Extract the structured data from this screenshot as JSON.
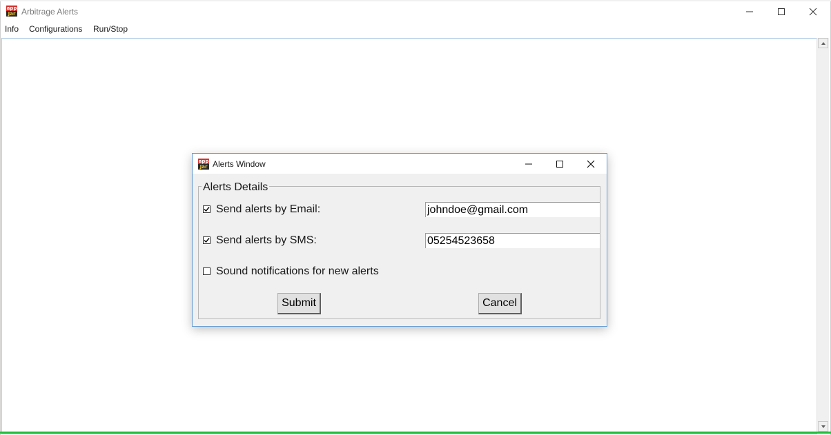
{
  "main_window": {
    "title": "Arbitrage Alerts",
    "icon": "app-jar-icon",
    "menu": [
      "Info",
      "Configurations",
      "Run/Stop"
    ]
  },
  "dialog": {
    "title": "Alerts Window",
    "group_title": "Alerts Details",
    "email": {
      "label": "Send alerts by Email:",
      "checked": true,
      "value": "johndoe@gmail.com"
    },
    "sms": {
      "label": "Send alerts by SMS:",
      "checked": true,
      "value": "05254523658"
    },
    "sound": {
      "label": "Sound notifications for new alerts",
      "checked": false
    },
    "submit_label": "Submit",
    "cancel_label": "Cancel"
  },
  "colors": {
    "dialog_border": "#6a9fd4",
    "dialog_bg": "#f0f0f0",
    "status_line": "#1fbf3a"
  }
}
